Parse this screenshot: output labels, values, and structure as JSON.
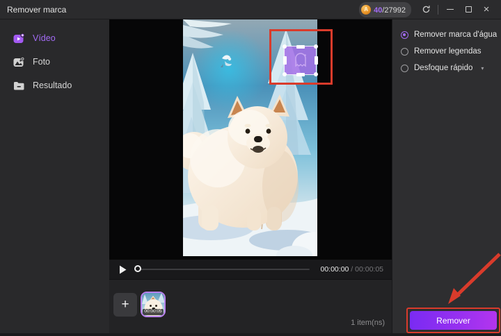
{
  "window": {
    "title": "Remover marca",
    "credits": {
      "used": "40",
      "total": "/27992",
      "coin_letter": "A"
    }
  },
  "sidebar": {
    "items": [
      {
        "label": "Vídeo",
        "active": true
      },
      {
        "label": "Foto",
        "active": false
      },
      {
        "label": "Resultado",
        "active": false
      }
    ]
  },
  "options": {
    "items": [
      {
        "label": "Remover marca d'água",
        "selected": true
      },
      {
        "label": "Remover legendas",
        "selected": false
      },
      {
        "label": "Desfoque rápido",
        "selected": false,
        "caret": "▾"
      }
    ]
  },
  "player": {
    "current_time": "00:00:00",
    "total_time": " / 00:00:05"
  },
  "media_list": {
    "add_label": "+",
    "thumb_duration": "00:00:05",
    "count_text": "1 item(ns)"
  },
  "action": {
    "remove_label": "Remover"
  },
  "colors": {
    "accent_purple": "#a36bf5",
    "annotation_red": "#d93b2b",
    "button_gradient_start": "#7a2bf2",
    "button_gradient_end": "#b335ee",
    "watermark_fill": "rgba(163,108,230,0.82)"
  }
}
